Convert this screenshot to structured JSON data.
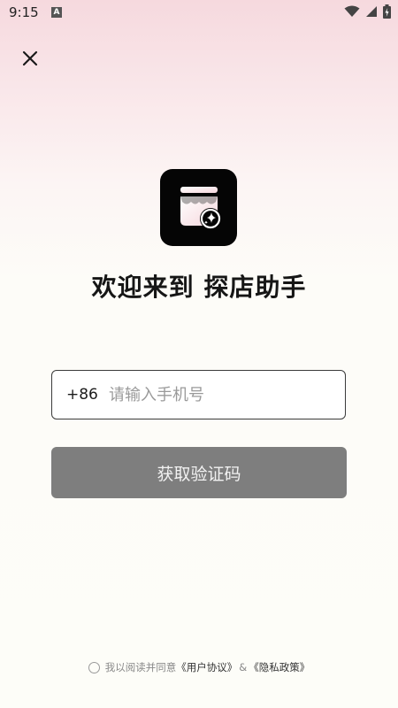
{
  "status_bar": {
    "time": "9:15",
    "notification_badge": "A"
  },
  "logo": {
    "icon": "storefront-sparkle-icon"
  },
  "welcome": {
    "title": "欢迎来到 探店助手"
  },
  "phone": {
    "country_code": "+86",
    "value": "",
    "placeholder": "请输入手机号"
  },
  "get_code_button": {
    "label": "获取验证码"
  },
  "agreement": {
    "prefix": "我以阅读并同意",
    "user_agreement": "《用户协议》",
    "separator": "&",
    "privacy_policy": "《隐私政策》"
  },
  "colors": {
    "button_bg": "#7e7e7e",
    "logo_bg": "#050505",
    "input_border": "#3b3b3b",
    "placeholder": "#9a9a9a",
    "gradient_top": "#f6d9de"
  }
}
